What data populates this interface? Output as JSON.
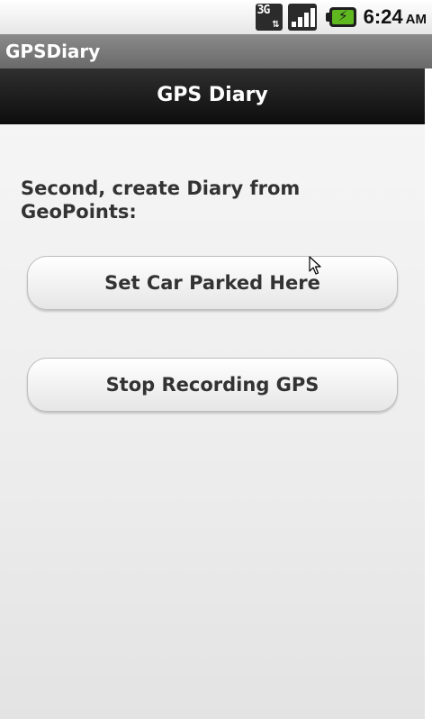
{
  "status_bar": {
    "network_type": "3G",
    "network_icon": "network-3g-icon",
    "signal_icon": "signal-strength-icon",
    "battery_icon": "battery-charging-icon",
    "time": "6:24",
    "ampm": "AM"
  },
  "window": {
    "title": "GPSDiary"
  },
  "app": {
    "header_title": "GPS Diary"
  },
  "main": {
    "instruction": "Second, create Diary from GeoPoints:",
    "buttons": {
      "set_car_parked": "Set Car Parked Here",
      "stop_recording": "Stop Recording GPS"
    }
  },
  "colors": {
    "header_bg": "#1a1a1a",
    "window_title_bg": "#7a7a7a",
    "battery_fill": "#5fb81f"
  }
}
